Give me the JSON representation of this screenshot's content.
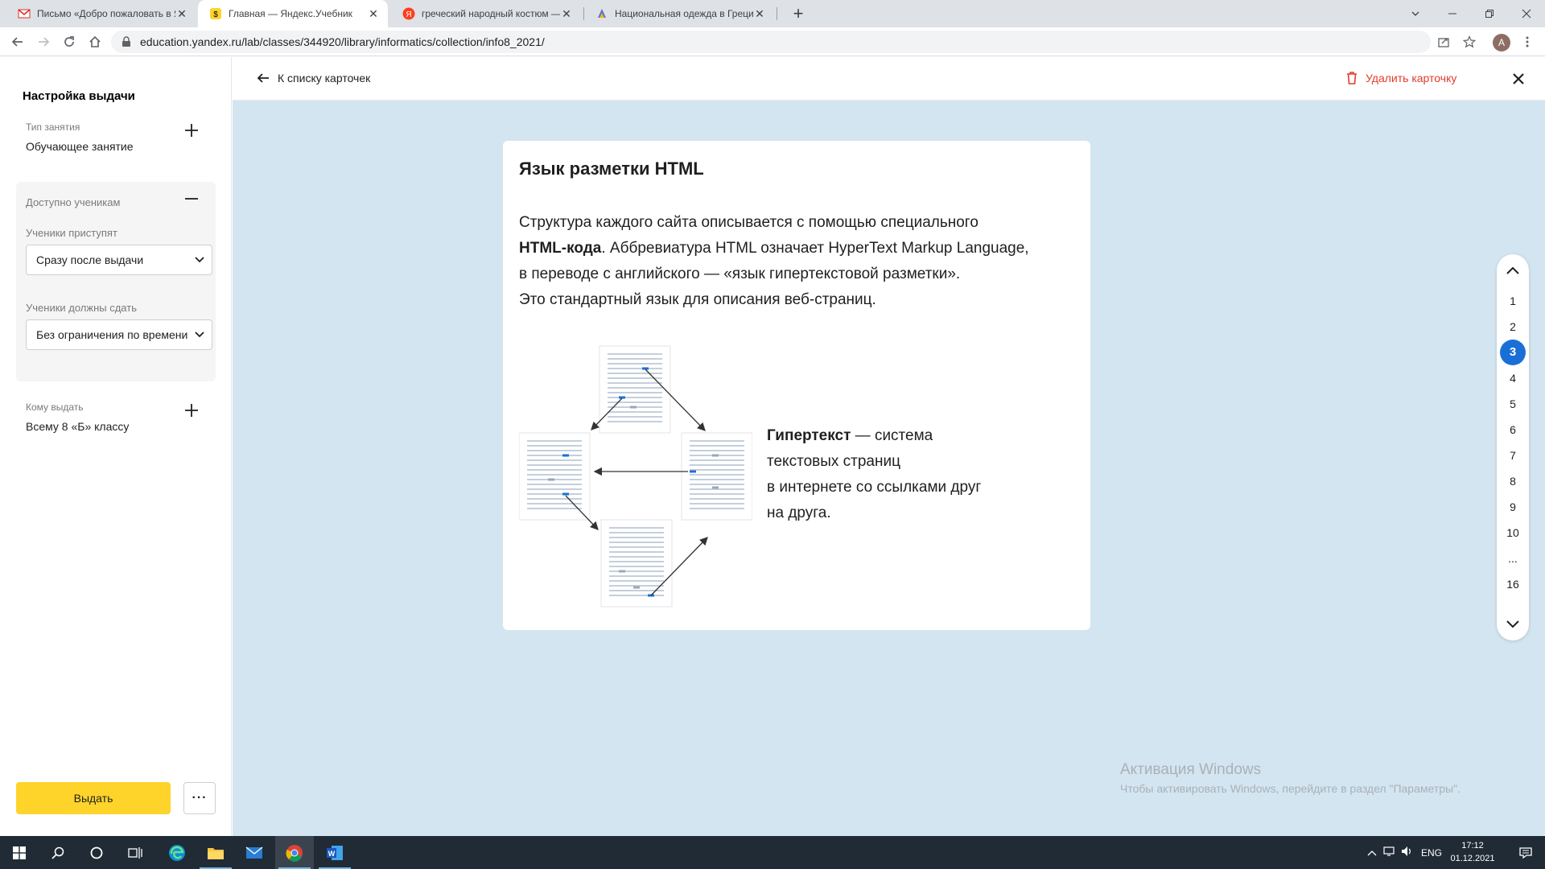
{
  "browser": {
    "tabs": [
      {
        "title": "Письмо «Добро пожаловать в Я",
        "favicon": "gmail-icon",
        "active": false
      },
      {
        "title": "Главная — Яндекс.Учебник",
        "favicon": "yandex-uchebnik-icon",
        "active": true
      },
      {
        "title": "греческий народный костюм —",
        "favicon": "yandex-icon",
        "active": false
      },
      {
        "title": "Национальная одежда в Греци",
        "favicon": "site-icon",
        "active": false
      }
    ],
    "url": "education.yandex.ru/lab/classes/344920/library/informatics/collection/info8_2021/",
    "profile_initial": "A"
  },
  "sidebar": {
    "title": "Настройка выдачи",
    "lesson_type_label": "Тип занятия",
    "lesson_type_value": "Обучающее занятие",
    "available_label": "Доступно ученикам",
    "start_label": "Ученики приступят",
    "start_value": "Сразу после выдачи",
    "due_label": "Ученики должны сдать",
    "due_value": "Без ограничения по времени",
    "assignee_label": "Кому выдать",
    "assignee_value": "Всему 8 «Б» классу",
    "issue_button": "Выдать",
    "more_button": "···"
  },
  "header": {
    "back_label": "К списку карточек",
    "delete_label": "Удалить карточку"
  },
  "card": {
    "title": "Язык разметки HTML",
    "para_line1": "Структура каждого сайта описывается с помощью специального",
    "para_bold": "HTML-кода",
    "para_line2_rest": ". Аббревиатура HTML означает HyperText Markup Language,",
    "para_line3": "в переводе с английского — «язык гипертекстовой разметки».",
    "para_line4": "Это стандартный язык для описания веб-страниц.",
    "hyper_bold": "Гипертекст",
    "hyper_rest_1": " — система",
    "hyper_line2": "текстовых страниц",
    "hyper_line3": "в интернете со ссылками друг",
    "hyper_line4": "на друга."
  },
  "pager": {
    "pages": [
      "1",
      "2",
      "3",
      "4",
      "5",
      "6",
      "7",
      "8",
      "9",
      "10",
      "...",
      "16"
    ],
    "current": "3"
  },
  "watermark": {
    "title": "Активация Windows",
    "subtitle": "Чтобы активировать Windows, перейдите в раздел \"Параметры\"."
  },
  "taskbar": {
    "language": "ENG",
    "time": "17:12",
    "date": "01.12.2021"
  },
  "colors": {
    "accent_blue": "#1a6fd6",
    "issue_yellow": "#fed42b",
    "delete_red": "#e13c2c",
    "main_bg": "#d3e5f0"
  }
}
